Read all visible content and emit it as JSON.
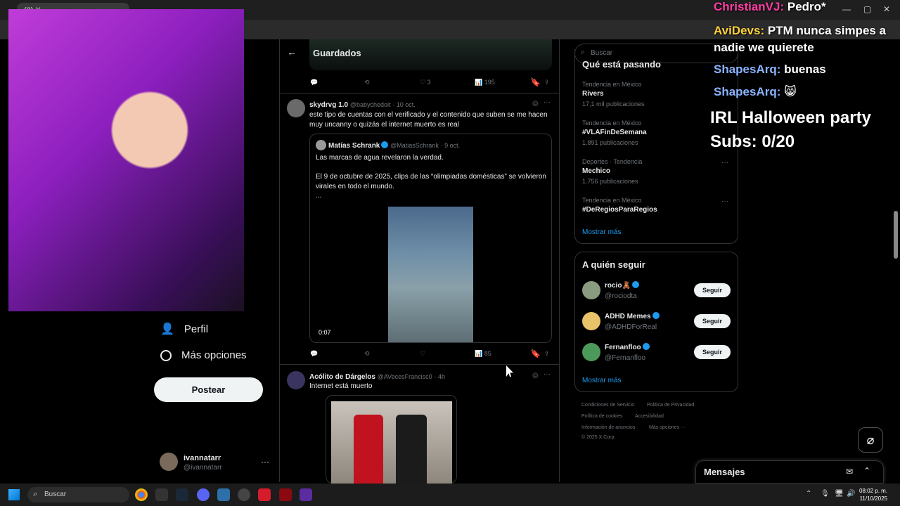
{
  "browser": {
    "tab_title": "(2) X",
    "window_controls": [
      "—",
      "▢",
      "✕"
    ]
  },
  "left_nav": {
    "items": [
      {
        "label": "Perfil",
        "icon": "person-icon"
      },
      {
        "label": "Más opciones",
        "icon": "more-circle-icon"
      }
    ],
    "post_button": "Postear",
    "account": {
      "name": "ivannatarr",
      "handle": "@ivannatarr",
      "more": "···"
    }
  },
  "header": {
    "title": "Guardados"
  },
  "tweets": [
    {
      "stats": {
        "likes": "3",
        "views": "195"
      }
    },
    {
      "author": "skydrvg 1.0",
      "handle": "@babychedoit",
      "date": "· 10 oct.",
      "text": "este tipo de cuentas con el verificado y el contenido que suben se me hacen muy uncanny o quizás el internet muerto es real",
      "quote": {
        "author": "Matías Schrank",
        "handle": "@MatiasSchrank",
        "date": "· 9 oct.",
        "line1": "Las marcas de agua revelaron la verdad.",
        "line2": "El 9 de octubre de 2025, clips de las “olimpiadas domésticas” se volvieron virales en todo el mundo.",
        "line3": "...",
        "video_time": "0:07"
      },
      "stats": {
        "views": "85"
      }
    },
    {
      "author": "Acólito de Dárgelos",
      "handle": "@AVecesFrancisc0",
      "date": "· 4h",
      "text": "Internet está muerto"
    }
  ],
  "right": {
    "search_placeholder": "Buscar",
    "trends_title": "Qué está pasando",
    "trends": [
      {
        "context": "Tendencia en México",
        "name": "Rivers",
        "count": "17,1 mil publicaciones"
      },
      {
        "context": "Tendencia en México",
        "name": "#VLAFinDeSemana",
        "count": "1.891 publicaciones"
      },
      {
        "context": "Deportes · Tendencia",
        "name": "Mechico",
        "count": "1.756 publicaciones"
      },
      {
        "context": "Tendencia en México",
        "name": "#DeRegiosParaRegios",
        "count": ""
      }
    ],
    "show_more": "Mostrar más",
    "who_to_follow_title": "A quién seguir",
    "follow_list": [
      {
        "name": "rocio🧸",
        "handle": "@rociodta",
        "button": "Seguir",
        "avatar_color": "#8a9c80"
      },
      {
        "name": "ADHD Memes",
        "handle": "@ADHDForReal",
        "button": "Seguir",
        "avatar_color": "#e8c36a"
      },
      {
        "name": "Fernanfloo",
        "handle": "@Fernanfloo",
        "button": "Seguir",
        "avatar_color": "#4c9a5a"
      }
    ],
    "show_more_2": "Mostrar más",
    "footer": [
      "Condiciones de Servicio",
      "Política de Privacidad",
      "Política de cookies",
      "Accesibilidad",
      "Información de anuncios",
      "Más opciones ···",
      "© 2025 X Corp."
    ],
    "messages": "Mensajes"
  },
  "overlay": {
    "chat": [
      {
        "user": "ChristianVJ:",
        "msg": "Pedro*",
        "user_color": "#ff3ea5"
      },
      {
        "user": "AviDevs:",
        "msg": "PTM nunca simpes a nadie we quierete",
        "user_color": "#ffd23c"
      },
      {
        "user": "ShapesArq:",
        "msg": "buenas",
        "user_color": "#8ab4ff"
      },
      {
        "user": "ShapesArq:",
        "msg": "😸",
        "user_color": "#8ab4ff"
      }
    ],
    "goal": "IRL Halloween party Subs: 0/20"
  },
  "taskbar": {
    "search": "Buscar",
    "time": "08:02 p. m.",
    "date": "11/10/2025"
  }
}
